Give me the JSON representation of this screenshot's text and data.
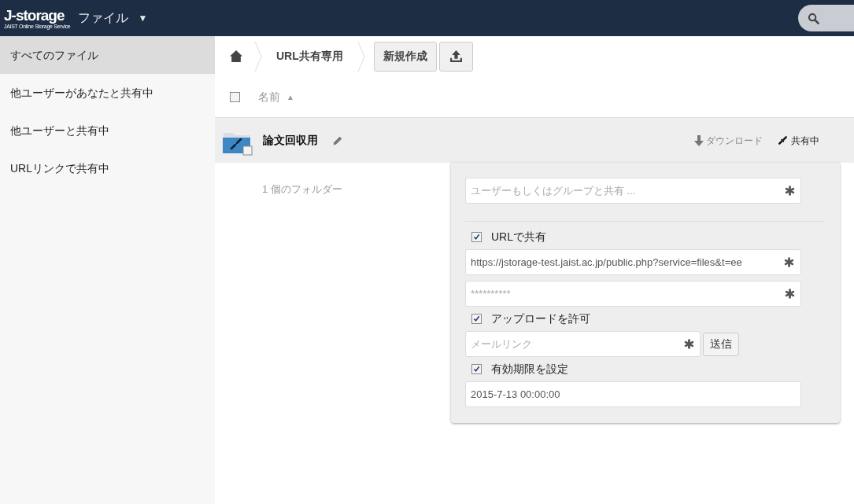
{
  "header": {
    "logo": "J-storage",
    "logo_subtitle": "JAIST Online Storage Service",
    "app_menu": "ファイル",
    "app_menu_caret": "▼"
  },
  "sidebar": {
    "items": [
      {
        "label": "すべてのファイル",
        "selected": true
      },
      {
        "label": "他ユーザーがあなたと共有中",
        "selected": false
      },
      {
        "label": "他ユーザーと共有中",
        "selected": false
      },
      {
        "label": "URLリンクで共有中",
        "selected": false
      }
    ]
  },
  "breadcrumb": {
    "items": [
      "URL共有専用"
    ]
  },
  "toolbar": {
    "new_button": "新規作成"
  },
  "table": {
    "select_all": {
      "checked": false
    },
    "columns": [
      {
        "label": "名前",
        "sort_indicator": "▲"
      }
    ],
    "rows": [
      {
        "name": "論文回収用",
        "actions": [
          {
            "kind": "download",
            "label": "ダウンロード"
          },
          {
            "kind": "shared",
            "label": "共有中"
          }
        ]
      }
    ],
    "summary": "1 個のフォルダー"
  },
  "share_panel": {
    "share_with": {
      "placeholder": "ユーザーもしくはグループと共有 ..."
    },
    "url_share": {
      "label": "URLで共有",
      "checked": true
    },
    "url": {
      "value": "https://jstorage-test.jaist.ac.jp/public.php?service=files&t=ee"
    },
    "password": {
      "placeholder": "**********"
    },
    "allow_upload": {
      "label": "アップロードを許可",
      "checked": true
    },
    "mail": {
      "placeholder": "メールリンク"
    },
    "send_button": "送信",
    "expiration": {
      "label": "有効期限を設定",
      "checked": true
    },
    "expiration_date": {
      "value": "2015-7-13 00:00:00"
    }
  }
}
